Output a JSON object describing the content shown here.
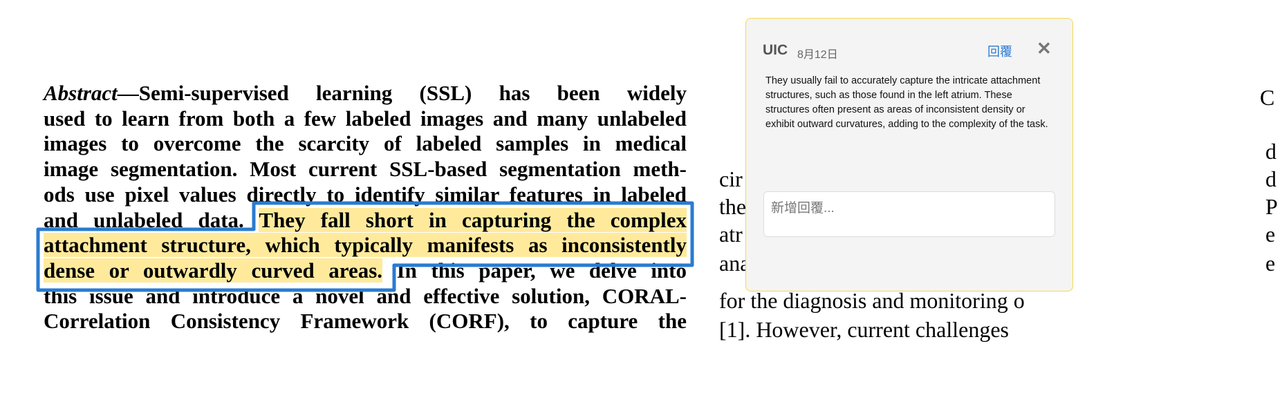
{
  "paper": {
    "left_lines": [
      {
        "parts": [
          {
            "t": "Abstract",
            "i": true
          },
          {
            "t": "—Semi-supervised learning (SSL) has been widely"
          }
        ]
      },
      {
        "parts": [
          {
            "t": "used to learn from both a few labeled images and many unlabeled"
          }
        ]
      },
      {
        "parts": [
          {
            "t": "images to overcome the scarcity of labeled samples in medical"
          }
        ]
      },
      {
        "parts": [
          {
            "t": "image segmentation. Most current SSL-based segmentation meth-"
          }
        ]
      },
      {
        "parts": [
          {
            "t": "ods use pixel values directly to identify similar features in labeled"
          }
        ]
      },
      {
        "parts": [
          {
            "t": "and unlabeled data. "
          },
          {
            "t": "They fall short in capturing the complex",
            "h": true
          }
        ]
      },
      {
        "parts": [
          {
            "t": "attachment structure, which typically manifests as inconsistently",
            "h": true
          }
        ]
      },
      {
        "parts": [
          {
            "t": "dense or outwardly curved areas.",
            "h": true
          },
          {
            "t": " In this paper, we delve into"
          }
        ]
      },
      {
        "parts": [
          {
            "t": "this issue and introduce a novel and effective solution, CORAL-"
          }
        ]
      },
      {
        "parts": [
          {
            "t": "Correlation Consistency Framework (CORF), to capture the"
          }
        ]
      }
    ],
    "right_fragments": {
      "left": [
        "cir",
        "the",
        "atr",
        "ana"
      ],
      "right": [
        "C",
        "d",
        "d",
        "P",
        "e",
        "e"
      ],
      "full_lines": [
        "for the diagnosis and monitoring o",
        "[1]. However, current challenges"
      ]
    }
  },
  "comment": {
    "author": "UIC",
    "date": "8月12日",
    "reply_label": "回覆",
    "close_icon": "close-icon",
    "text": "They usually fail to accurately capture the intricate attachment structures, such as those found in the left atrium. These structures often present as areas of inconsistent density or exhibit outward curvatures, adding to the complexity of the task.",
    "reply_placeholder": "新增回覆..."
  },
  "colors": {
    "highlight": "#ffea9c",
    "selection_outline": "#2a7bd0",
    "popup_border": "#f3d84f",
    "reply_link": "#2b7bd4"
  }
}
